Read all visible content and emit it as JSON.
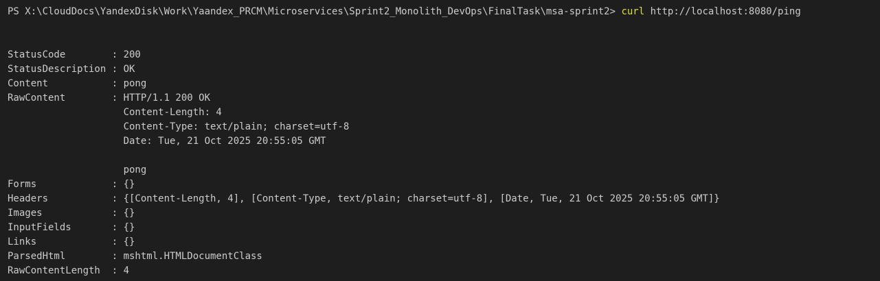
{
  "prompt": {
    "path": "PS X:\\CloudDocs\\YandexDisk\\Work\\Yaandex_PRCM\\Microservices\\Sprint2_Monolith_DevOps\\FinalTask\\msa-sprint2> ",
    "command": "curl",
    "args": " http://localhost:8080/ping"
  },
  "output": [
    "StatusCode        : 200",
    "StatusDescription : OK",
    "Content           : pong",
    "RawContent        : HTTP/1.1 200 OK",
    "                    Content-Length: 4",
    "                    Content-Type: text/plain; charset=utf-8",
    "                    Date: Tue, 21 Oct 2025 20:55:05 GMT",
    "",
    "                    pong",
    "Forms             : {}",
    "Headers           : {[Content-Length, 4], [Content-Type, text/plain; charset=utf-8], [Date, Tue, 21 Oct 2025 20:55:05 GMT]}",
    "Images            : {}",
    "InputFields       : {}",
    "Links             : {}",
    "ParsedHtml        : mshtml.HTMLDocumentClass",
    "RawContentLength  : 4"
  ],
  "colors": {
    "background": "#1e1e1e",
    "text": "#cccccc",
    "command": "#dcdc48"
  }
}
